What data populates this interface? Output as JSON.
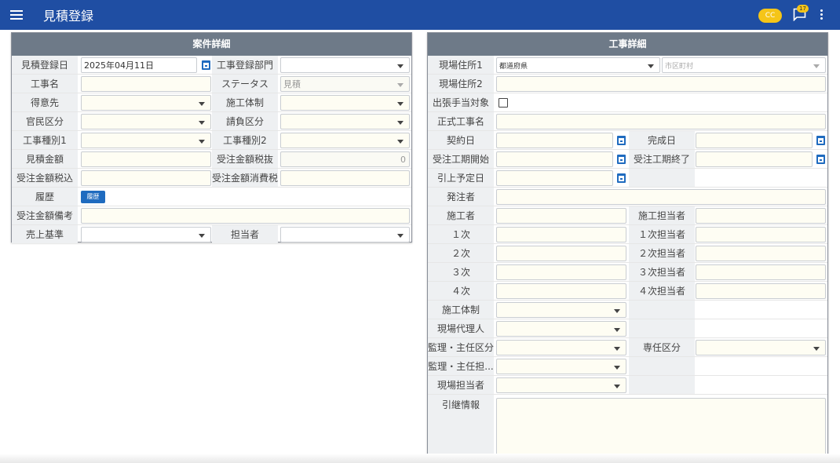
{
  "appbar": {
    "title": "見積登録",
    "avatar": "CC",
    "notification_badge": "17"
  },
  "left_panel": {
    "title": "案件詳細",
    "labels": {
      "estimate_date": "見積登録日",
      "dept": "工事登録部門",
      "project_name": "工事名",
      "status": "ステータス",
      "customer": "得意先",
      "system": "施工体制",
      "public_private": "官民区分",
      "contract_type": "請負区分",
      "type1": "工事種別1",
      "type2": "工事種別2",
      "estimate_amount": "見積金額",
      "order_excl": "受注金額税抜",
      "order_incl": "受注金額税込",
      "order_tax": "受注金額消費税",
      "history": "履歴",
      "order_note": "受注金額備考",
      "sales_basis": "売上基準",
      "person": "担当者"
    },
    "values": {
      "estimate_date": "2025年04月11日",
      "status": "見積",
      "order_excl": "0",
      "history_button": "履歴"
    }
  },
  "right_panel": {
    "title": "工事詳細",
    "labels": {
      "address1": "現場住所1",
      "address2": "現場住所2",
      "travel": "出張手当対象",
      "official_name": "正式工事名",
      "contract_date": "契約日",
      "completion_date": "完成日",
      "period_start": "受注工期開始",
      "period_end": "受注工期終了",
      "pullout_date": "引上予定日",
      "orderer": "発注者",
      "builder": "施工者",
      "builder_person": "施工担当者",
      "tier1": "１次",
      "tier1_person": "１次担当者",
      "tier2": "２次",
      "tier2_person": "２次担当者",
      "tier3": "３次",
      "tier3_person": "３次担当者",
      "tier4": "４次",
      "tier4_person": "４次担当者",
      "system": "施工体制",
      "site_agent": "現場代理人",
      "supervisor_type": "監理・主任区分",
      "dedicated_type": "専任区分",
      "supervisor_person": "監理・主任担...",
      "site_person": "現場担当者",
      "handover": "引継情報"
    },
    "placeholders": {
      "prefecture": "都道府県",
      "city": "市区町村"
    }
  },
  "colors": {
    "appbar": "#1f4ea3",
    "panel_header": "#6e7a88",
    "accent": "#1f6bbf",
    "avatar": "#f5c518"
  },
  "icons": [
    "menu-icon",
    "chat-icon",
    "more-vert-icon",
    "calendar-icon",
    "chevron-down-icon",
    "checkbox-icon"
  ]
}
